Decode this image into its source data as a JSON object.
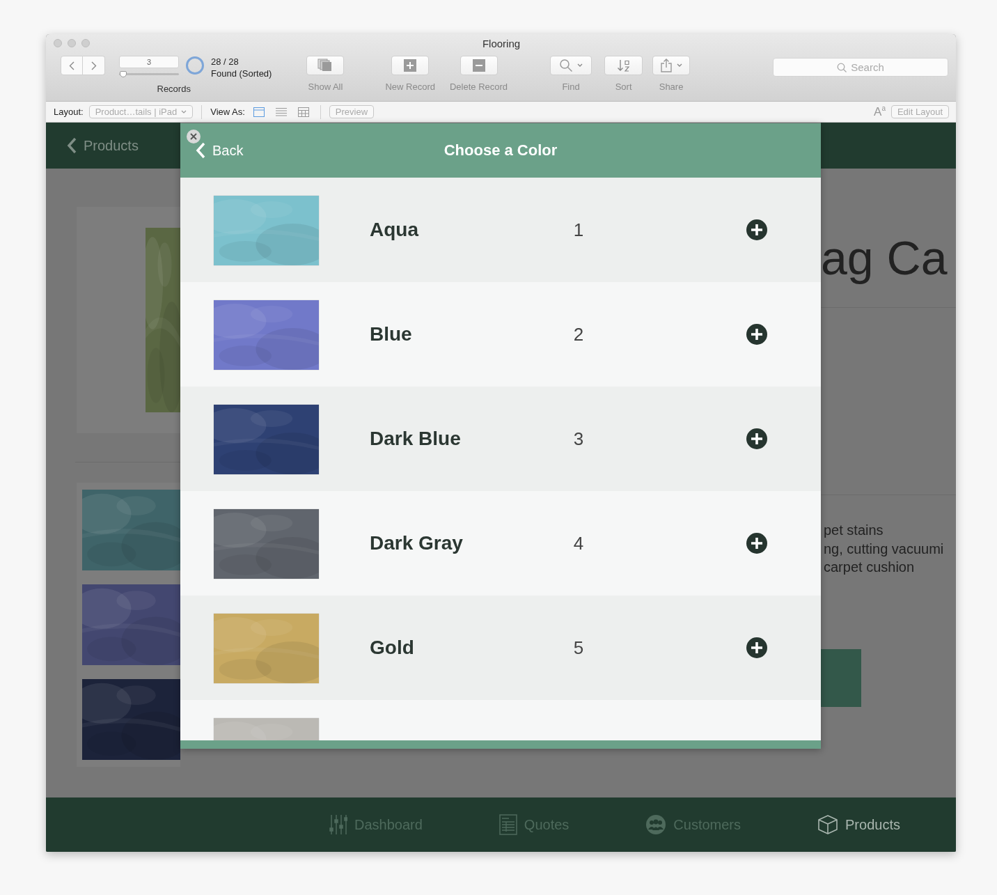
{
  "window": {
    "title": "Flooring"
  },
  "toolbar": {
    "record_number": "3",
    "record_slider": {
      "level": 0.07
    },
    "found_count": "28 / 28",
    "found_state": "Found (Sorted)",
    "records_label": "Records",
    "buttons": [
      {
        "kind": "show_all",
        "label": "Show All"
      },
      {
        "kind": "new_record",
        "label": "New Record"
      },
      {
        "kind": "delete_record",
        "label": "Delete Record"
      },
      {
        "kind": "find",
        "label": "Find"
      },
      {
        "kind": "sort",
        "label": "Sort"
      },
      {
        "kind": "share",
        "label": "Share"
      }
    ],
    "search": {
      "placeholder": "Search"
    }
  },
  "layout_bar": {
    "layout_label": "Layout:",
    "layout_value": "Product…tails | iPad",
    "view_as_label": "View As:",
    "view_modes": [
      {
        "kind": "form",
        "selected": true
      },
      {
        "kind": "list",
        "selected": false
      },
      {
        "kind": "table",
        "selected": false
      }
    ],
    "preview": "Preview",
    "text_size": "A$^{a}$",
    "edit_layout": "Edit Layout"
  },
  "background": {
    "back_label": "Products",
    "title_fragment": "ag Ca",
    "description_lines": [
      "pet stains",
      "ng, cutting vacuumi",
      "carpet cushion"
    ]
  },
  "modal": {
    "back": "Back",
    "title": "Choose a Color",
    "rows": [
      {
        "kind": "color",
        "name": "Aqua",
        "number": "1"
      },
      {
        "kind": "color",
        "name": "Blue",
        "number": "2"
      },
      {
        "kind": "color",
        "name": "Dark Blue",
        "number": "3"
      },
      {
        "kind": "color",
        "name": "Dark Gray",
        "number": "4"
      },
      {
        "kind": "color",
        "name": "Gold",
        "number": "5"
      },
      {
        "kind": "partial"
      }
    ]
  },
  "bottom_nav": [
    {
      "kind": "dashboard",
      "label": "Dashboard",
      "selected": false
    },
    {
      "kind": "quotes",
      "label": "Quotes",
      "selected": false
    },
    {
      "kind": "customers",
      "label": "Customers",
      "selected": false
    },
    {
      "kind": "products",
      "label": "Products",
      "selected": true
    }
  ]
}
